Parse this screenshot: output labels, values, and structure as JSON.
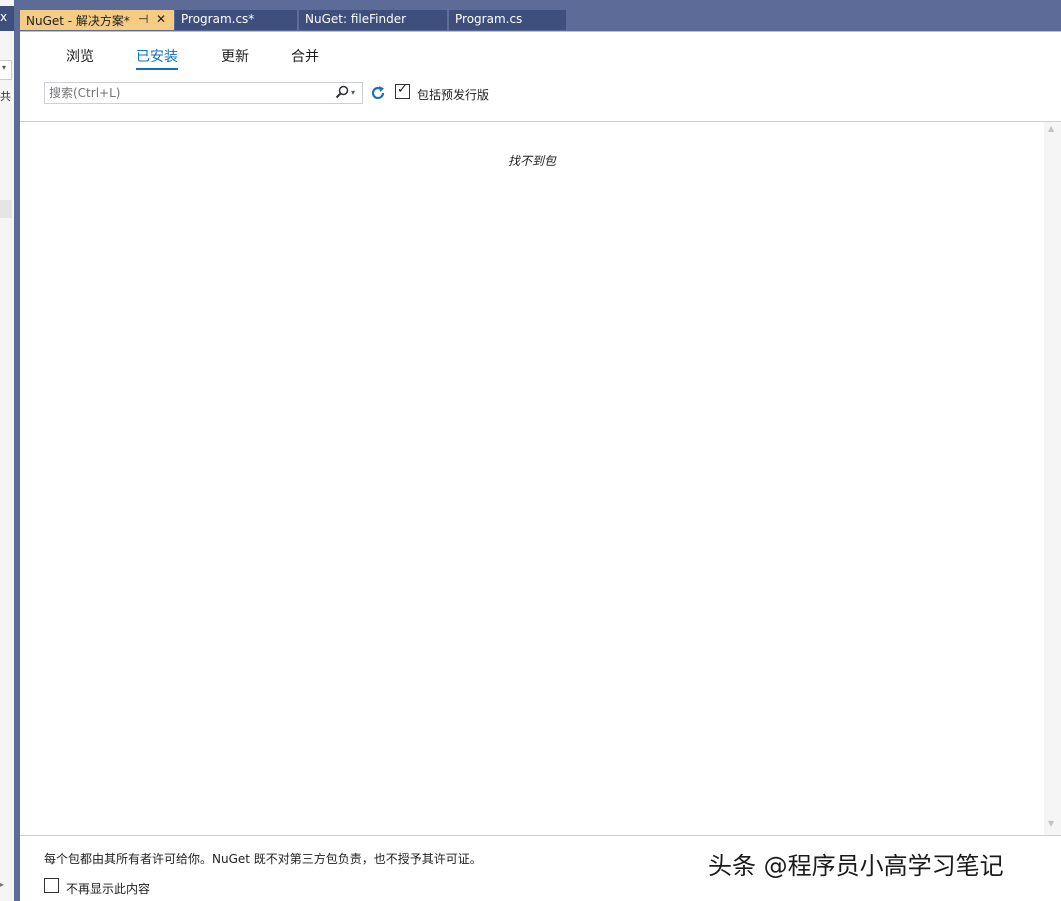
{
  "left_panel": {
    "close_glyph": "x",
    "text_fragment": "共",
    "dropdown_glyph": "▾",
    "scroll_glyph": "▸"
  },
  "tabs": [
    {
      "label": "NuGet - 解决方案*",
      "active": true,
      "pin": "⊣",
      "close": "✕"
    },
    {
      "label": "Program.cs*",
      "active": false
    },
    {
      "label": "NuGet: fileFinder",
      "active": false
    },
    {
      "label": "Program.cs",
      "active": false
    }
  ],
  "nuget": {
    "nav_tabs": [
      {
        "label": "浏览",
        "active": false
      },
      {
        "label": "已安装",
        "active": true
      },
      {
        "label": "更新",
        "active": false
      },
      {
        "label": "合并",
        "active": false
      }
    ],
    "search": {
      "placeholder": "搜索(Ctrl+L)",
      "value": "",
      "dropdown_glyph": "▾"
    },
    "include_prerelease": {
      "label": "包括预发行版",
      "checked": true,
      "tick": "✓"
    },
    "empty_message": "找不到包",
    "scroll_up": "▲",
    "scroll_down": "▼",
    "license_notice": "每个包都由其所有者许可给你。NuGet 既不对第三方包负责，也不授予其许可证。",
    "dont_show_again": {
      "label": "不再显示此内容",
      "checked": false
    }
  },
  "watermark": "头条 @程序员小高学习笔记",
  "icons": {
    "search": "search-icon",
    "refresh": "refresh-icon"
  },
  "colors": {
    "accent": "#0e70c0",
    "active_tab": "#f5cc84",
    "tab_bg": "#3e4f7d",
    "frame": "#5d6b99"
  }
}
